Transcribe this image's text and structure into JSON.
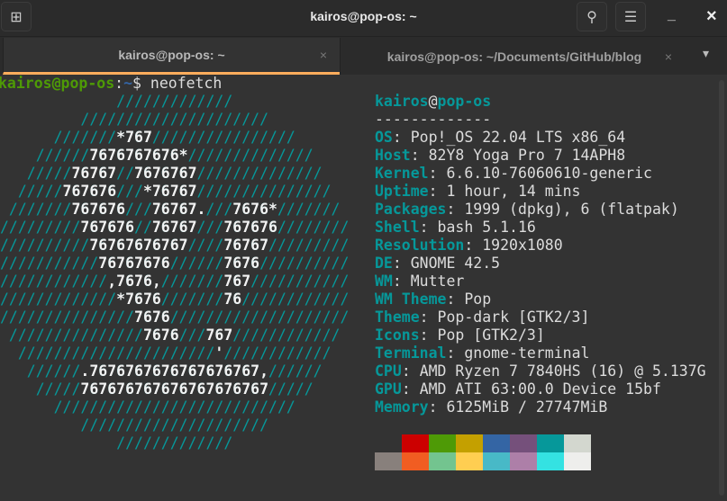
{
  "window": {
    "title": "kairos@pop-os: ~",
    "new_tab_icon": "new-tab-icon",
    "search_icon": "search-icon",
    "menu_icon": "hamburger-menu-icon",
    "minimize": "_",
    "close": "×"
  },
  "tabs": [
    {
      "label": "kairos@pop-os: ~",
      "active": true,
      "close": "×"
    },
    {
      "label": "kairos@pop-os: ~/Documents/GitHub/blog",
      "active": false,
      "close": "×"
    }
  ],
  "tabs_dropdown": "▾",
  "terminal": {
    "prompt": {
      "user_host": "kairos@pop-os",
      "sep": ":",
      "path": "~",
      "symbol": "$ ",
      "command": "neofetch"
    },
    "ascii_art": [
      "             /////////////",
      "         /////////////////////",
      "      ///////*767////////////////",
      "    //////7676767676*//////////////",
      "   /////76767//7676767//////////////",
      "  /////767676///*76767///////////////",
      " ///////767676///76767.///7676*///////",
      "/////////767676//76767///767676////////",
      "//////////76767676767////76767/////////",
      "///////////76767676//////7676//////////",
      "////////////,7676,///////767///////////",
      "/////////////*7676///////76////////////",
      "///////////////7676////////////////////",
      " ///////////////7676///767////////////",
      "  //////////////////////'////////////",
      "   //////.7676767676767676767,//////",
      "    /////767676767676767676767/////",
      "      ///////////////////////////",
      "         /////////////////////",
      "             /////////////"
    ],
    "info_title": {
      "user": "kairos",
      "at": "@",
      "host": "pop-os"
    },
    "separator": "-------------",
    "info": [
      {
        "key": "OS",
        "value": "Pop!_OS 22.04 LTS x86_64"
      },
      {
        "key": "Host",
        "value": "82Y8 Yoga Pro 7 14APH8"
      },
      {
        "key": "Kernel",
        "value": "6.6.10-76060610-generic"
      },
      {
        "key": "Uptime",
        "value": "1 hour, 14 mins"
      },
      {
        "key": "Packages",
        "value": "1999 (dpkg), 6 (flatpak)"
      },
      {
        "key": "Shell",
        "value": "bash 5.1.16"
      },
      {
        "key": "Resolution",
        "value": "1920x1080"
      },
      {
        "key": "DE",
        "value": "GNOME 42.5"
      },
      {
        "key": "WM",
        "value": "Mutter"
      },
      {
        "key": "WM Theme",
        "value": "Pop"
      },
      {
        "key": "Theme",
        "value": "Pop-dark [GTK2/3]"
      },
      {
        "key": "Icons",
        "value": "Pop [GTK2/3]"
      },
      {
        "key": "Terminal",
        "value": "gnome-terminal"
      },
      {
        "key": "CPU",
        "value": "AMD Ryzen 7 7840HS (16) @ 5.137G"
      },
      {
        "key": "GPU",
        "value": "AMD ATI 63:00.0 Device 15bf"
      },
      {
        "key": "Memory",
        "value": "6125MiB / 27747MiB"
      }
    ],
    "palette": [
      [
        "#333333",
        "#cc0000",
        "#4e9a06",
        "#c4a000",
        "#3465a4",
        "#75507b",
        "#06989a",
        "#d3d7cf"
      ],
      [
        "#88807c",
        "#f15d22",
        "#73c48f",
        "#ffce51",
        "#48b9c7",
        "#ad7fa8",
        "#34e2e2",
        "#eeeeec"
      ]
    ]
  }
}
